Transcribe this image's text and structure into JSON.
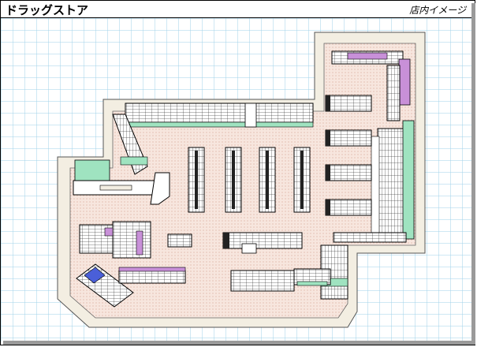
{
  "header": {
    "title": "ドラッグストア",
    "subtitle": "店内イメージ"
  },
  "colors": {
    "grid_line": "#9fd2ea",
    "floor": "#f5e0d6",
    "wall": "#f3eee2",
    "shelf_outline": "#000000",
    "accent_purple": "#c890d8",
    "accent_green": "#9fe3c0",
    "accent_teal": "#7fd6c8",
    "accent_blue": "#4a5fd8"
  },
  "icons": {
    "floor_plan": "store-floor-plan"
  }
}
